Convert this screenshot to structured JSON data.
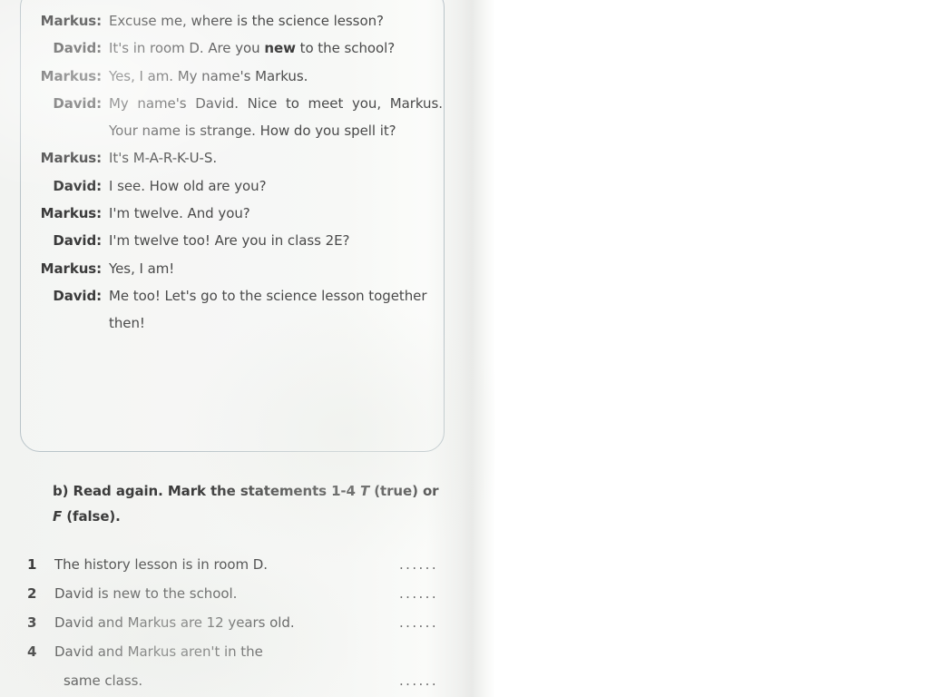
{
  "page": {
    "background_color": "#f4f5f3",
    "paper_edge_color": "#e9eae8"
  },
  "dialogue_box": {
    "border_color": "#b9c4c9",
    "lines": [
      {
        "speaker": "Markus:",
        "text": "Excuse me, where is the science lesson?",
        "justify": true
      },
      {
        "speaker": "David:",
        "text": "It's in room D. Are you new to the school?",
        "justify": true,
        "bold_word": "new"
      },
      {
        "speaker": "Markus:",
        "text": "Yes, I am. My name's Markus.",
        "justify": false
      },
      {
        "speaker": "David:",
        "text": "My name's David. Nice to meet you, Markus. Your name is strange. How do you spell it?",
        "justify": true
      },
      {
        "speaker": "Markus:",
        "text": "It's M-A-R-K-U-S.",
        "justify": false
      },
      {
        "speaker": "David:",
        "text": "I see. How old are you?",
        "justify": false
      },
      {
        "speaker": "Markus:",
        "text": "I'm twelve. And you?",
        "justify": false
      },
      {
        "speaker": "David:",
        "text": "I'm twelve too! Are you in class 2E?",
        "justify": false
      },
      {
        "speaker": "Markus:",
        "text": "Yes, I am!",
        "justify": false
      },
      {
        "speaker": "David:",
        "text": "Me too! Let's go to the science lesson together then!",
        "justify": false
      }
    ]
  },
  "exercise": {
    "instruction_part1": "b) Read again. Mark the statements 1-4 ",
    "instruction_italic1": "T",
    "instruction_part2": " (true) or ",
    "instruction_italic2": "F",
    "instruction_part3": " (false).",
    "answer_dots": "......",
    "statements": [
      {
        "number": "1",
        "text": "The history lesson is in room D.",
        "has_dots": true
      },
      {
        "number": "2",
        "text": "David is new to the school.",
        "has_dots": true
      },
      {
        "number": "3",
        "text": "David and Markus are 12 years old.",
        "has_dots": true
      },
      {
        "number": "4",
        "text": "David and Markus aren't in the",
        "has_dots": false
      },
      {
        "number": "",
        "text": "same class.",
        "has_dots": true,
        "continuation": true
      }
    ]
  }
}
